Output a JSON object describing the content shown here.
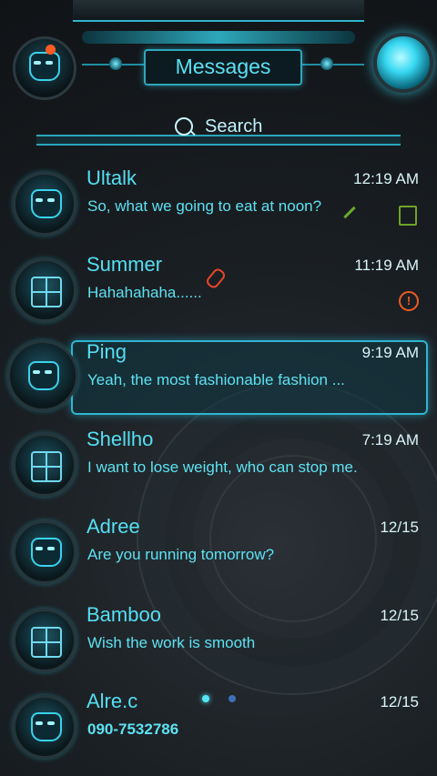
{
  "header": {
    "title": "Messages",
    "search_label": "Search",
    "notification_color": "#ff5b22"
  },
  "conversations": [
    {
      "name": "Ultalk",
      "time": "12:19 AM",
      "preview": "So, what we going to eat at noon?",
      "avatar": "robot-face",
      "badge": "draft-note-icon"
    },
    {
      "name": "Summer",
      "time": "11:19 AM",
      "preview": "Hahahahaha......",
      "avatar": "grid-face",
      "badge": "error-icon",
      "attachment": "paperclip-icon"
    },
    {
      "name": "Ping",
      "time": "9:19 AM",
      "preview": "Yeah, the most fashionable fashion ...",
      "avatar": "robot-face",
      "selected": true
    },
    {
      "name": "Shellho",
      "time": "7:19 AM",
      "preview": "I want to lose weight, who can stop me.",
      "avatar": "grid-face"
    },
    {
      "name": "Adree",
      "time": "12/15",
      "preview": "Are you running tomorrow?",
      "avatar": "robot-face"
    },
    {
      "name": "Bamboo",
      "time": "12/15",
      "preview": "Wish the work is smooth",
      "avatar": "grid-face"
    },
    {
      "name": "Alre.c",
      "time": "12/15",
      "preview": "090-7532786",
      "avatar": "robot-face"
    }
  ],
  "pager": {
    "pages": 2,
    "active": 1
  },
  "colors": {
    "accent": "#4fd8ec",
    "frame": "#2eb6cf",
    "error": "#f05a22",
    "draft": "#6ea32a"
  }
}
